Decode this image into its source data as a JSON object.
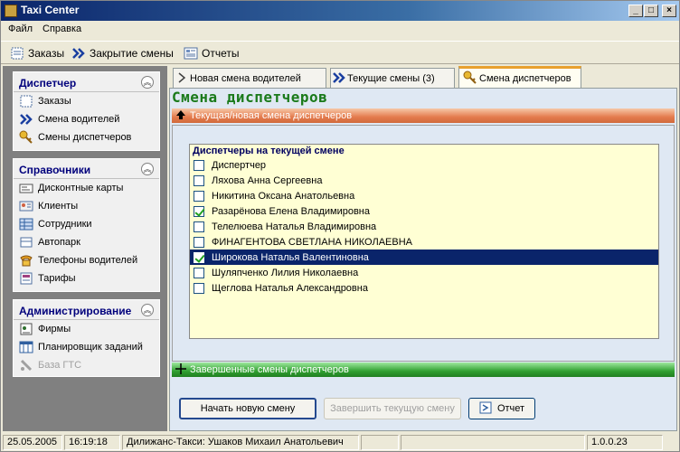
{
  "window": {
    "title": "Taxi Center"
  },
  "menu": {
    "file": "Файл",
    "help": "Справка"
  },
  "toolbar": {
    "orders": "Заказы",
    "close_shift": "Закрытие смены",
    "reports": "Отчеты"
  },
  "sidebar": {
    "dispatcher": {
      "title": "Диспетчер",
      "items": [
        "Заказы",
        "Смена водителей",
        "Смены диспетчеров"
      ]
    },
    "references": {
      "title": "Справочники",
      "items": [
        "Дисконтные карты",
        "Клиенты",
        "Сотрудники",
        "Автопарк",
        "Телефоны водителей",
        "Тарифы"
      ]
    },
    "admin": {
      "title": "Администрирование",
      "items": [
        "Фирмы",
        "Планировщик заданий",
        "База ГТС"
      ]
    }
  },
  "tabs": [
    "Новая смена водителей",
    "Текущие смены (3)",
    "Смена диспетчеров"
  ],
  "main": {
    "title": "Смена диспетчеров",
    "current_bar": "Текущая/новая смена диспетчеров",
    "finished_bar": "Завершенные смены диспетчеров",
    "list_header": "Диспетчеры на текущей смене",
    "dispatchers": [
      {
        "name": "Диспертчер",
        "checked": false
      },
      {
        "name": "Ляхова Анна Сергеевна",
        "checked": false
      },
      {
        "name": "Никитина Оксана Анатольевна",
        "checked": false
      },
      {
        "name": "Разарёнова Елена Владимировна",
        "checked": true
      },
      {
        "name": "Телелюева Наталья Владимировна",
        "checked": false
      },
      {
        "name": "ФИНАГЕНТОВА СВЕТЛАНА НИКОЛАЕВНА",
        "checked": false
      },
      {
        "name": "Широкова Наталья Валентиновна",
        "checked": true,
        "selected": true
      },
      {
        "name": "Шуляпченко Лилия Николаевна",
        "checked": false
      },
      {
        "name": "Щеглова Наталья Александровна",
        "checked": false
      }
    ],
    "buttons": {
      "start": "Начать новую смену",
      "finish": "Завершить текущую смену",
      "report": "Отчет"
    }
  },
  "status": {
    "date": "25.05.2005",
    "time": "16:19:18",
    "user": "Дилижанс-Такси: Ушаков Михаил Анатольевич",
    "version": "1.0.0.23"
  }
}
